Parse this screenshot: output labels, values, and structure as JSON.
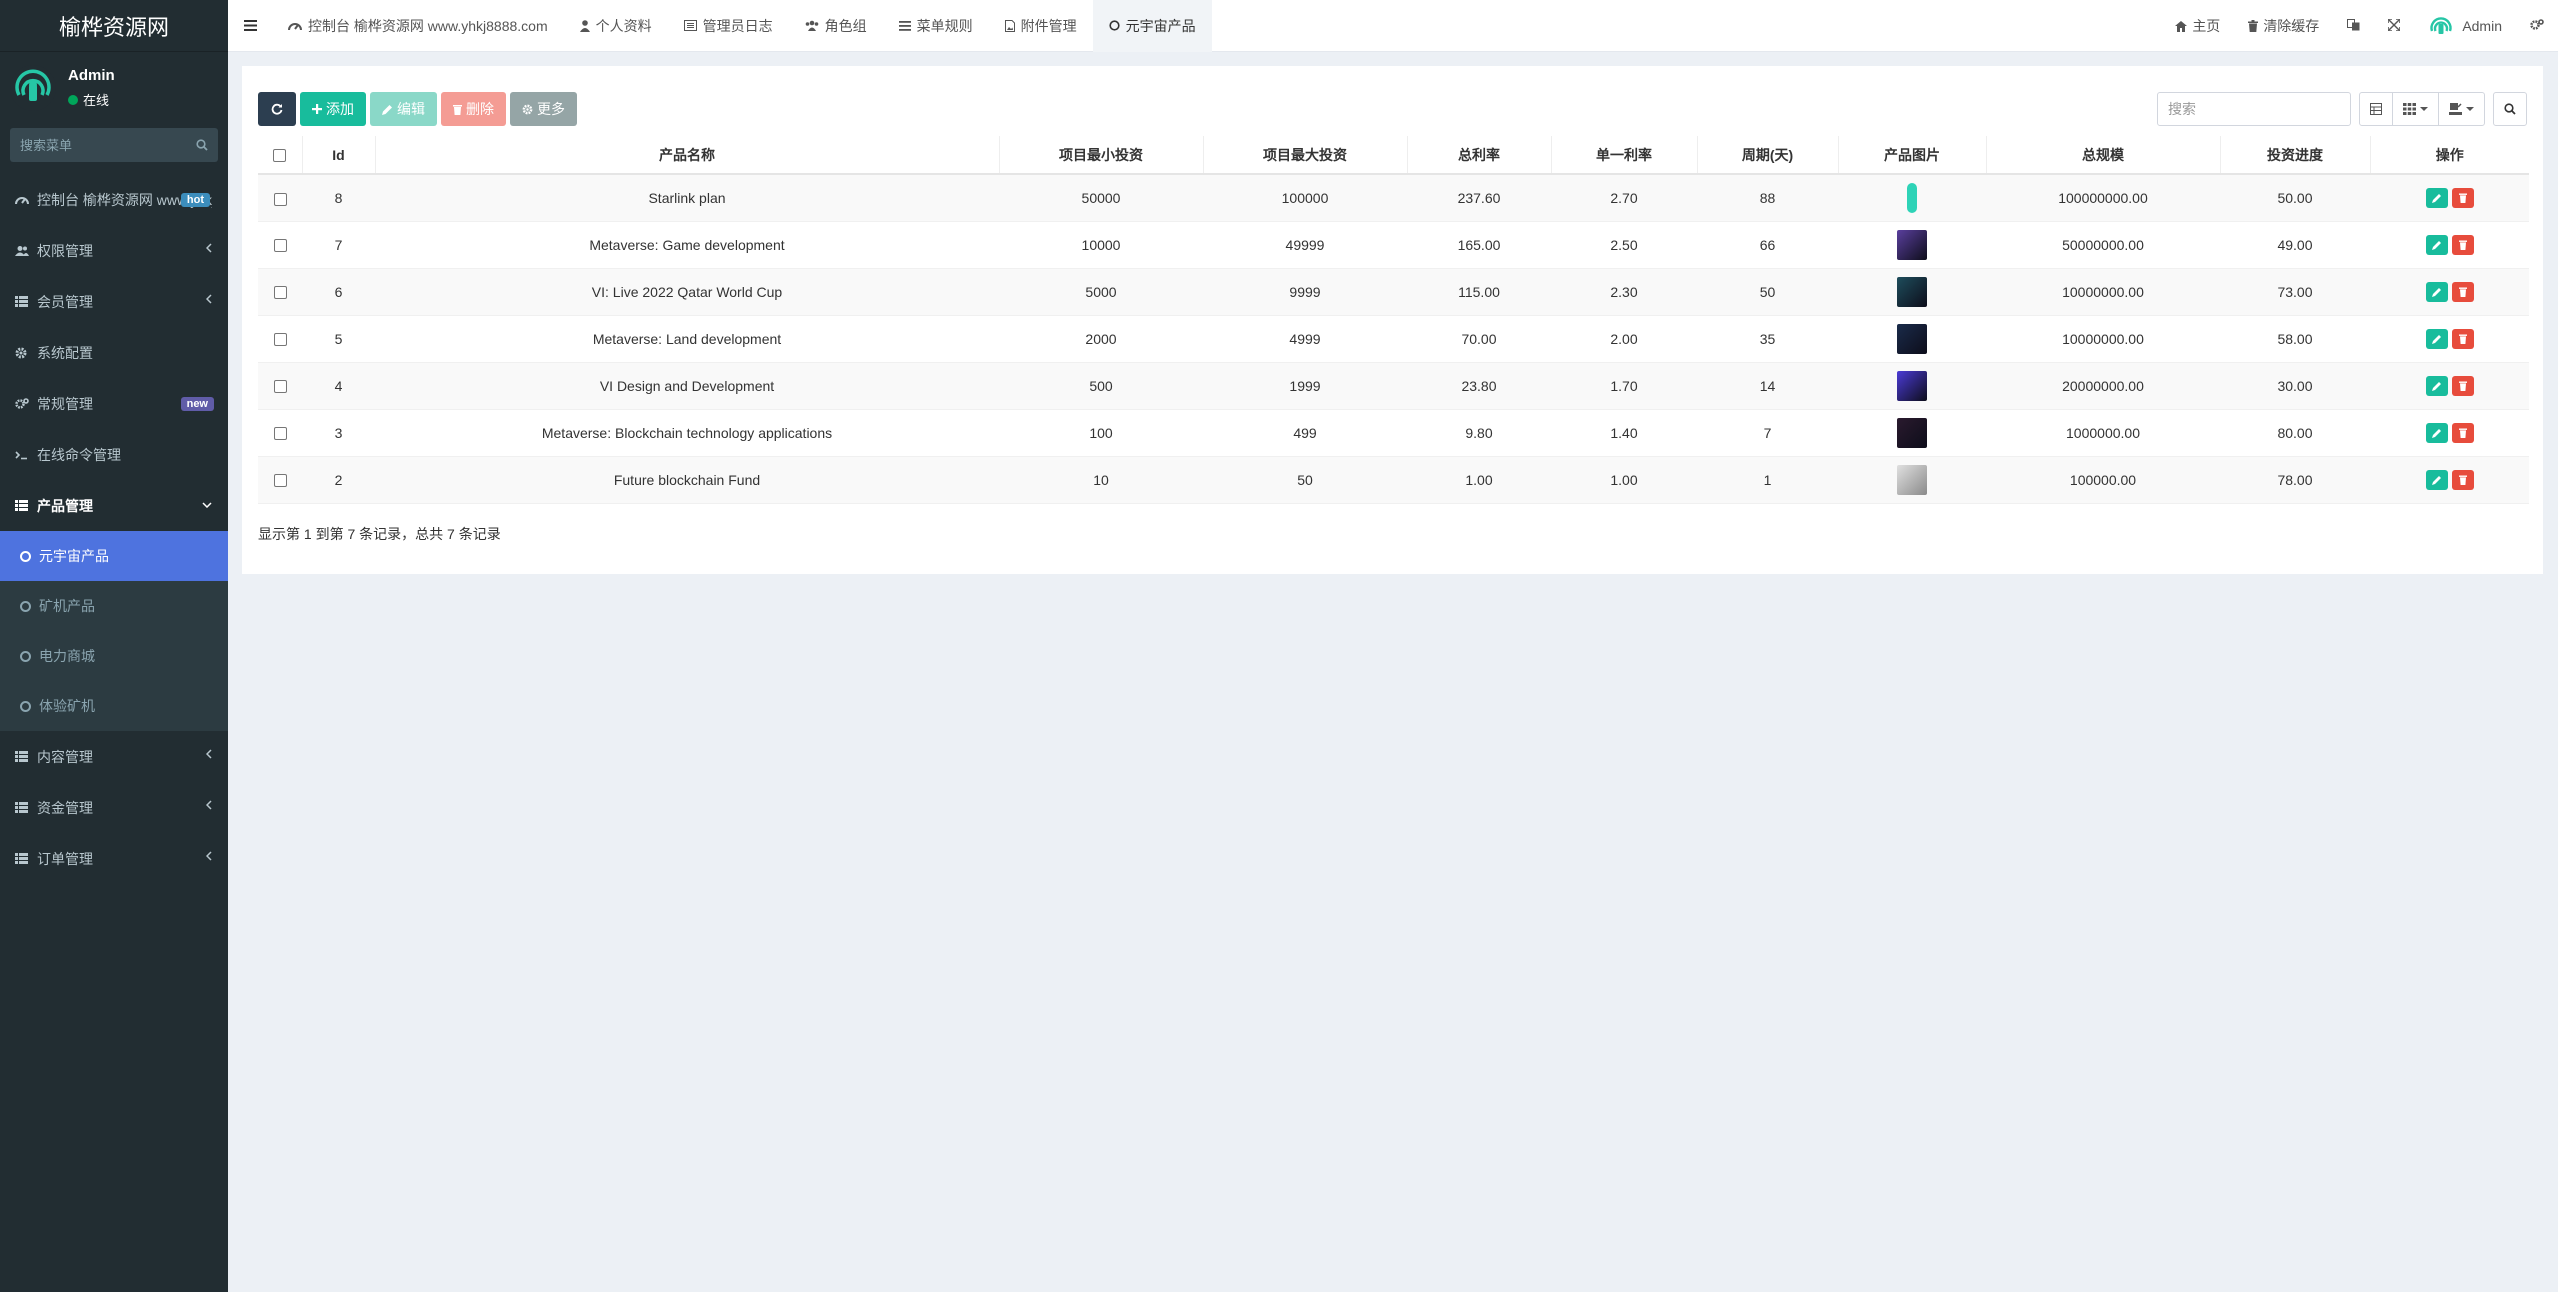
{
  "app": {
    "title": "榆桦资源网"
  },
  "user": {
    "name": "Admin",
    "status": "在线"
  },
  "sidebar": {
    "search_placeholder": "搜索菜单",
    "items": [
      {
        "label": "控制台 榆桦资源网 www.yhkj8888.com",
        "icon": "dashboard-icon",
        "badge": "hot"
      },
      {
        "label": "权限管理",
        "icon": "users-icon"
      },
      {
        "label": "会员管理",
        "icon": "list-icon"
      },
      {
        "label": "系统配置",
        "icon": "cog-icon"
      },
      {
        "label": "常规管理",
        "icon": "cogs-icon",
        "badge": "new"
      },
      {
        "label": "在线命令管理",
        "icon": "terminal-icon"
      },
      {
        "label": "产品管理",
        "icon": "list-icon"
      },
      {
        "label": "内容管理",
        "icon": "list-icon"
      },
      {
        "label": "资金管理",
        "icon": "list-icon"
      },
      {
        "label": "订单管理",
        "icon": "list-icon"
      }
    ],
    "product_sub": [
      "元宇宙产品",
      "矿机产品",
      "电力商城",
      "体验矿机"
    ]
  },
  "header": {
    "tabs": [
      {
        "label": "控制台 榆桦资源网 www.yhkj8888.com",
        "icon": "dashboard-icon"
      },
      {
        "label": "个人资料",
        "icon": "user-icon"
      },
      {
        "label": "管理员日志",
        "icon": "list-alt-icon"
      },
      {
        "label": "角色组",
        "icon": "group-icon"
      },
      {
        "label": "菜单规则",
        "icon": "bars-icon"
      },
      {
        "label": "附件管理",
        "icon": "file-image-icon"
      },
      {
        "label": "元宇宙产品",
        "icon": "circle-o-icon"
      }
    ],
    "home": "主页",
    "clear_cache": "清除缓存",
    "admin": "Admin"
  },
  "toolbar": {
    "add": "添加",
    "edit": "编辑",
    "delete": "删除",
    "more": "更多",
    "search_placeholder": "搜索"
  },
  "table": {
    "columns": [
      "Id",
      "产品名称",
      "项目最小投资",
      "项目最大投资",
      "总利率",
      "单一利率",
      "周期(天)",
      "产品图片",
      "总规模",
      "投资进度",
      "操作"
    ],
    "rows": [
      {
        "id": "8",
        "name": "Starlink plan",
        "min": "50000",
        "max": "100000",
        "total_rate": "237.60",
        "single_rate": "2.70",
        "cycle": "88",
        "scale": "100000000.00",
        "progress": "50.00",
        "img_color": "#2ed3b7"
      },
      {
        "id": "7",
        "name": "Metaverse: Game development",
        "min": "10000",
        "max": "49999",
        "total_rate": "165.00",
        "single_rate": "2.50",
        "cycle": "66",
        "scale": "50000000.00",
        "progress": "49.00",
        "img_color": "#5a3f9e"
      },
      {
        "id": "6",
        "name": "VI: Live 2022 Qatar World Cup",
        "min": "5000",
        "max": "9999",
        "total_rate": "115.00",
        "single_rate": "2.30",
        "cycle": "50",
        "scale": "10000000.00",
        "progress": "73.00",
        "img_color": "#1e4d5c"
      },
      {
        "id": "5",
        "name": "Metaverse: Land development",
        "min": "2000",
        "max": "4999",
        "total_rate": "70.00",
        "single_rate": "2.00",
        "cycle": "35",
        "scale": "10000000.00",
        "progress": "58.00",
        "img_color": "#1a2b4a"
      },
      {
        "id": "4",
        "name": "VI Design and Development",
        "min": "500",
        "max": "1999",
        "total_rate": "23.80",
        "single_rate": "1.70",
        "cycle": "14",
        "scale": "20000000.00",
        "progress": "30.00",
        "img_color": "#4b3bd6"
      },
      {
        "id": "3",
        "name": "Metaverse: Blockchain technology applications",
        "min": "100",
        "max": "499",
        "total_rate": "9.80",
        "single_rate": "1.40",
        "cycle": "7",
        "scale": "1000000.00",
        "progress": "80.00",
        "img_color": "#2a1a2e"
      },
      {
        "id": "2",
        "name": "Future blockchain Fund",
        "min": "10",
        "max": "50",
        "total_rate": "1.00",
        "single_rate": "1.00",
        "cycle": "1",
        "scale": "100000.00",
        "progress": "78.00",
        "img_color": "#b5b5b5"
      }
    ]
  },
  "footer": {
    "info": "显示第 1 到第 7 条记录，总共 7 条记录"
  },
  "colors": {
    "sidebar_bg": "#222d32",
    "active": "#4e73df",
    "success": "#18bc9c",
    "danger": "#e74c3c"
  }
}
